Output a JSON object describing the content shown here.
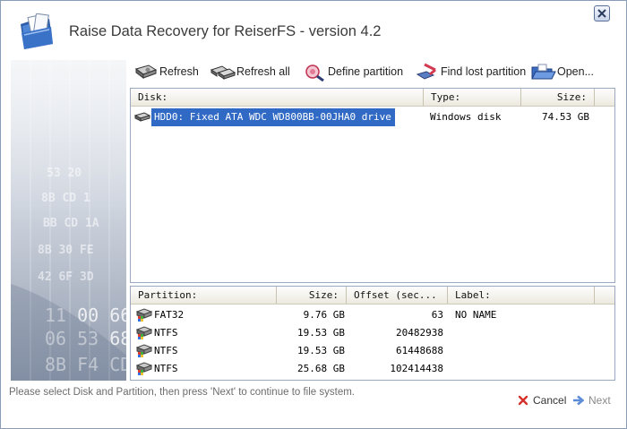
{
  "window": {
    "title": "Raise Data Recovery for ReiserFS - version 4.2",
    "icon": "folder-documents-icon"
  },
  "toolbar": {
    "items": [
      {
        "label": "Refresh",
        "icon": "hard-disk-refresh-icon"
      },
      {
        "label": "Refresh all",
        "icon": "hard-disk-refresh-all-icon"
      },
      {
        "label": "Define partition",
        "icon": "define-partition-icon"
      },
      {
        "label": "Find lost partition",
        "icon": "find-partition-icon"
      },
      {
        "label": "Open...",
        "icon": "open-folder-icon"
      }
    ]
  },
  "disks": {
    "columns": [
      "Disk:",
      "Type:",
      "Size:"
    ],
    "rows": [
      {
        "name": "HDD0: Fixed ATA WDC WD800BB-00JHA0 drive",
        "type": "Windows disk",
        "size": "74.53 GB",
        "selected": true
      }
    ]
  },
  "partitions": {
    "columns": [
      "Partition:",
      "Size:",
      "Offset (sec...",
      "Label:"
    ],
    "rows": [
      {
        "name": "FAT32",
        "size": "9.76 GB",
        "offset": "63",
        "label": "NO NAME"
      },
      {
        "name": "NTFS",
        "size": "19.53 GB",
        "offset": "20482938",
        "label": ""
      },
      {
        "name": "NTFS",
        "size": "19.53 GB",
        "offset": "61448688",
        "label": ""
      },
      {
        "name": "NTFS",
        "size": "25.68 GB",
        "offset": "102414438",
        "label": ""
      }
    ]
  },
  "status": {
    "text": "Please select Disk and Partition, then press 'Next' to continue to file system."
  },
  "buttons": {
    "cancel": "Cancel",
    "next": "Next"
  },
  "colors": {
    "selection": "#316ac5",
    "border": "#9aa8c0"
  }
}
